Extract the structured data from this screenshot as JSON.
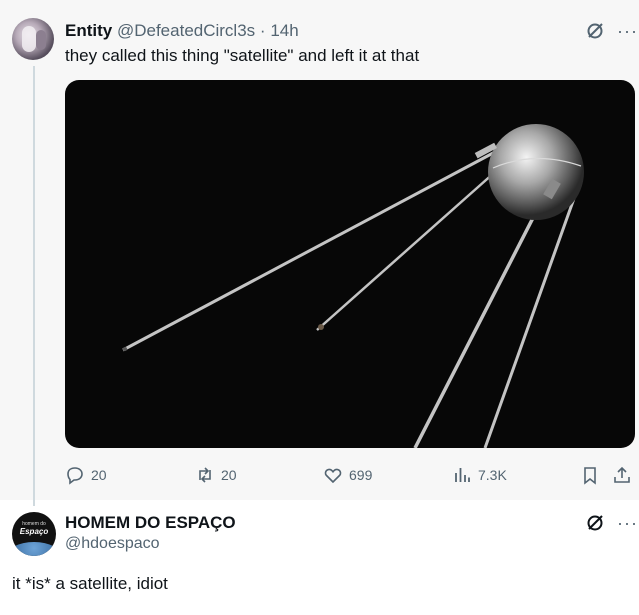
{
  "tweet": {
    "author_name": "Entity",
    "author_handle": "@DefeatedCircl3s",
    "separator": "·",
    "time": "14h",
    "text": "they called this thing \"satellite\" and left it at that",
    "media_alt_icon": "satellite-photo",
    "stats": {
      "replies": "20",
      "reposts": "20",
      "likes": "699",
      "views": "7.3K"
    }
  },
  "reply": {
    "author_name": "HOMEM DO ESPAÇO",
    "author_handle": "@hdoespaco",
    "avatar_line1": "homem do",
    "avatar_line2": "Espaço",
    "text": "it *is* a satellite, idiot"
  },
  "icons": {
    "grok": "grok-icon",
    "more": "more-icon",
    "reply": "reply-icon",
    "repost": "repost-icon",
    "like": "like-icon",
    "views": "views-icon",
    "bookmark": "bookmark-icon",
    "share": "share-icon"
  },
  "more_glyph": "···",
  "colors": {
    "text_primary": "#0f1419",
    "text_secondary": "#536471",
    "thread_line": "#cfd9de",
    "card_bg": "#f7f7f7"
  }
}
